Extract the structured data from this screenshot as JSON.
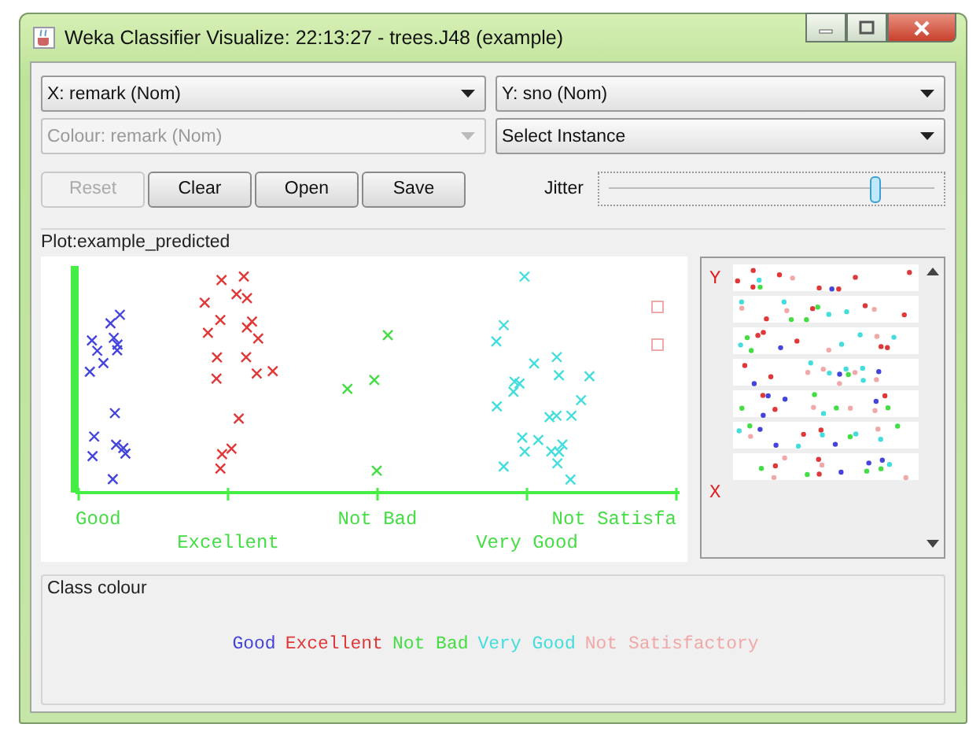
{
  "window": {
    "title": "Weka Classifier Visualize: 22:13:27 - trees.J48 (example)"
  },
  "selects": [
    {
      "value": "X: remark (Nom)",
      "disabled": false
    },
    {
      "value": "Y: sno (Nom)",
      "disabled": false
    },
    {
      "value": "Colour: remark (Nom)",
      "disabled": true
    },
    {
      "value": "Select Instance",
      "disabled": false
    }
  ],
  "buttons": [
    {
      "label": "Reset",
      "disabled": true
    },
    {
      "label": "Clear",
      "disabled": false
    },
    {
      "label": "Open",
      "disabled": false
    },
    {
      "label": "Save",
      "disabled": false
    }
  ],
  "jitter": {
    "label": "Jitter",
    "level": 0.8
  },
  "plot": {
    "title": "Plot:example_predicted",
    "x_labels": [
      "Good",
      "Excellent",
      "Not Bad",
      "Very Good",
      "Not Satisfa"
    ]
  },
  "attribute_panel": {
    "y_marker": "Y",
    "x_marker": "X"
  },
  "class_colour": {
    "title": "Class colour",
    "classes": [
      {
        "label": "Good",
        "color": "#4444dd"
      },
      {
        "label": "Excellent",
        "color": "#e03838"
      },
      {
        "label": "Not Bad",
        "color": "#44dd44"
      },
      {
        "label": "Very Good",
        "color": "#44dddd"
      },
      {
        "label": "Not Satisfactory",
        "color": "#f0a8a8"
      }
    ]
  }
}
